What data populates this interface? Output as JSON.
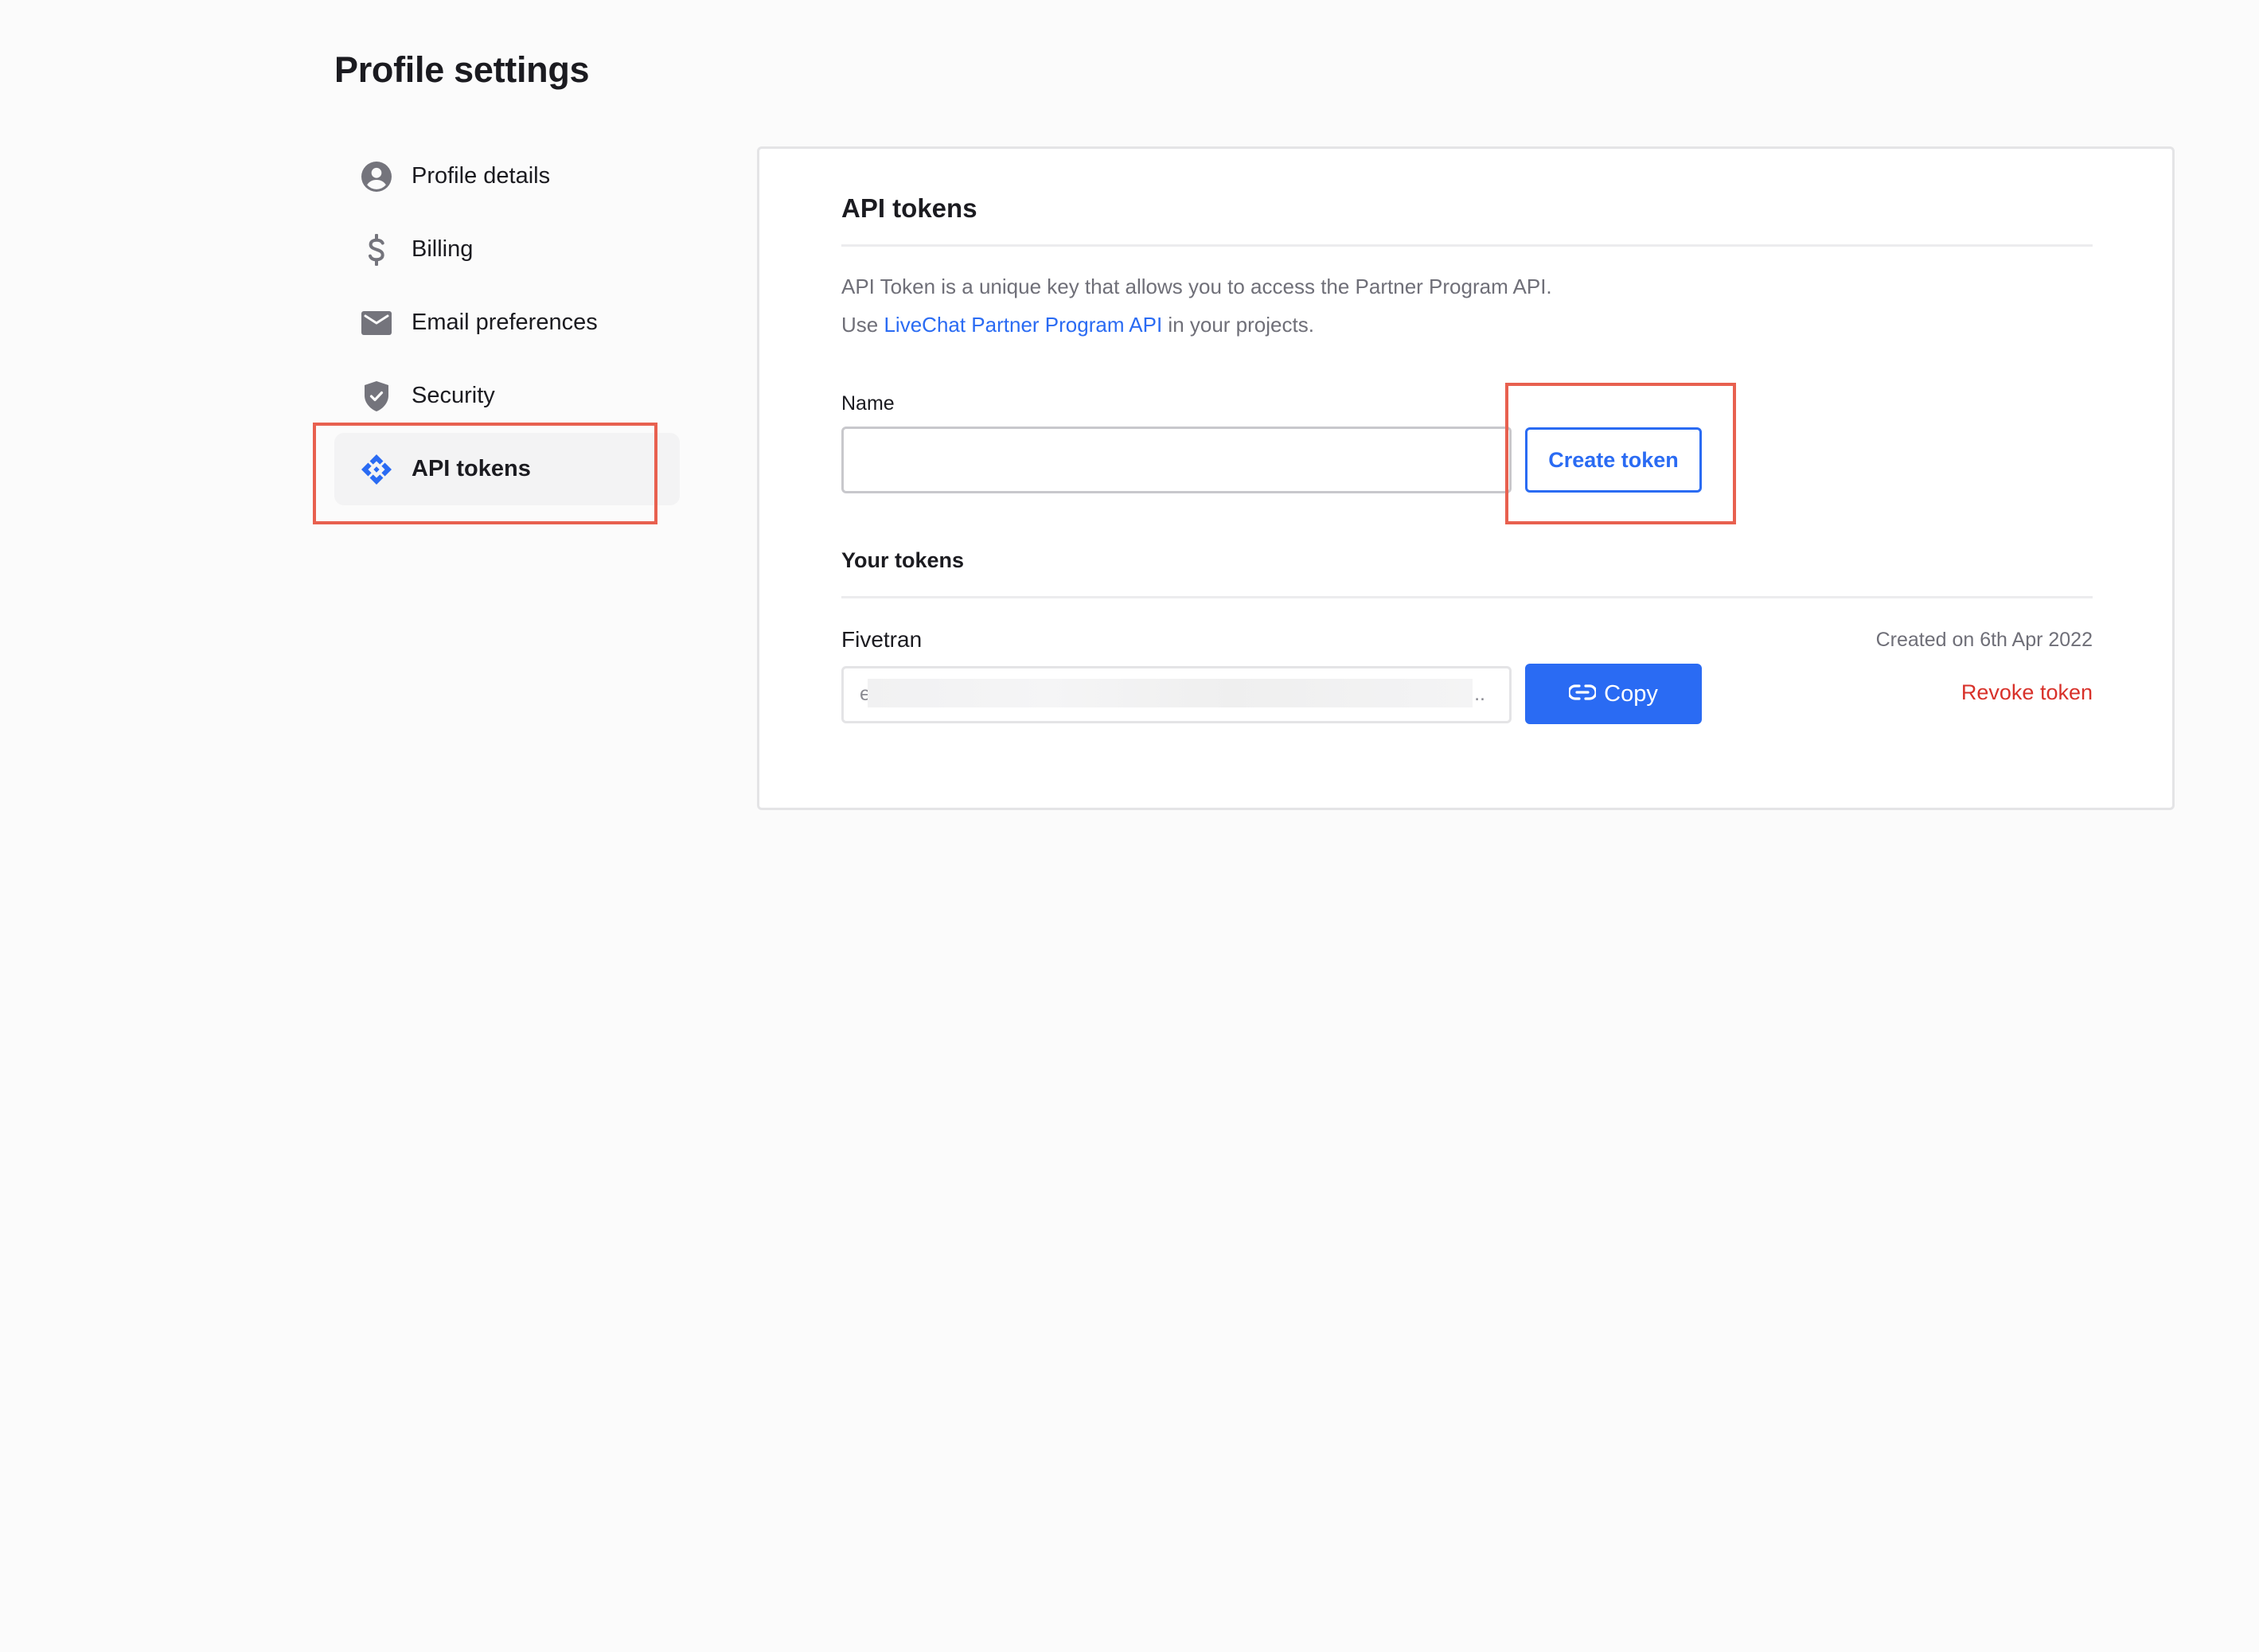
{
  "page": {
    "title": "Profile settings"
  },
  "sidebar": {
    "items": [
      {
        "label": "Profile details",
        "icon": "user-circle-icon",
        "active": false
      },
      {
        "label": "Billing",
        "icon": "dollar-icon",
        "active": false
      },
      {
        "label": "Email preferences",
        "icon": "envelope-icon",
        "active": false
      },
      {
        "label": "Security",
        "icon": "shield-check-icon",
        "active": false
      },
      {
        "label": "API tokens",
        "icon": "api-diamond-icon",
        "active": true
      }
    ]
  },
  "card": {
    "title": "API tokens",
    "description_line1": "API Token is a unique key that allows you to access the Partner Program API.",
    "description_line2_prefix": "Use ",
    "description_link": "LiveChat Partner Program API",
    "description_line2_suffix": " in your projects.",
    "name_label": "Name",
    "name_value": "",
    "name_placeholder": "",
    "create_button": "Create token",
    "tokens_section_title": "Your tokens",
    "tokens": [
      {
        "name": "Fivetran",
        "created": "Created on 6th Apr 2022",
        "value_visible_prefix": "ey",
        "value_redacted": true,
        "value_suffix": "..",
        "copy_label": "Copy",
        "copy_icon": "link-icon",
        "revoke_label": "Revoke token"
      }
    ]
  },
  "colors": {
    "accent": "#2a6bf3",
    "danger": "#d8312a",
    "highlight_annotation": "#e8604f",
    "icon_gray": "#74747c",
    "background": "#fbfbfb"
  }
}
